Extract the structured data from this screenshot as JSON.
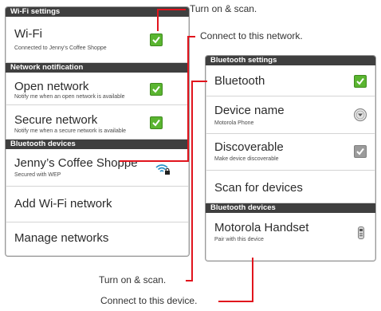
{
  "wifi_panel": {
    "header": "Wi-Fi settings",
    "wifi": {
      "title": "Wi-Fi",
      "subtitle": "Connected to Jenny's Coffee Shoppe",
      "checked": true
    },
    "network_header": "Network notification",
    "open_network": {
      "title": "Open network",
      "subtitle": "Notify me when an open network is available",
      "checked": true
    },
    "secure_network": {
      "title": "Secure network",
      "subtitle": "Notify me when a secure network is available",
      "checked": true
    },
    "bt_header": "Bluetooth devices",
    "jenny": {
      "title": "Jenny’s Coffee Shoppe",
      "subtitle": "Secured with WEP",
      "icon": "wifi-lock-icon"
    },
    "add_network": "Add Wi-Fi network",
    "manage_networks": "Manage networks"
  },
  "bt_panel": {
    "header": "Bluetooth settings",
    "bluetooth": {
      "title": "Bluetooth",
      "checked": true
    },
    "device_name": {
      "title": "Device name",
      "subtitle": "Motorola Phone",
      "icon": "chevron-circle-down-icon"
    },
    "discoverable": {
      "title": "Discoverable",
      "subtitle": "Make device discoverable",
      "checked": true,
      "state": "disabled"
    },
    "scan": "Scan for devices",
    "devices_header": "Bluetooth devices",
    "handset": {
      "title": "Motorola Handset",
      "subtitle": "Pair with this device",
      "icon": "phone-handset-icon"
    }
  },
  "callouts": {
    "wifi_turn_on": "Turn on & scan.",
    "connect_network": "Connect to this network.",
    "bt_turn_on": "Turn on & scan.",
    "connect_device": "Connect to this device."
  },
  "colors": {
    "accent_green": "#5ab530",
    "header_bg": "#3f3f3f",
    "callout_line": "#e1141d"
  }
}
